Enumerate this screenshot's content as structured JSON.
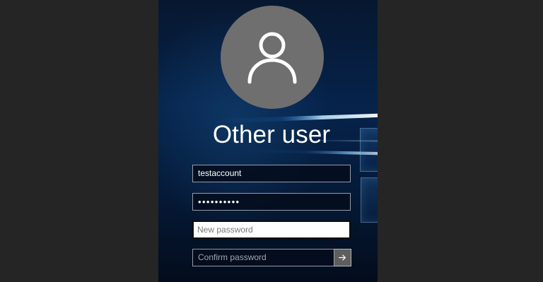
{
  "screen": {
    "background_color": "#252525",
    "panel_gradient_top": "#07172f",
    "panel_gradient_bottom": "#030c1c"
  },
  "user": {
    "avatar_icon": "user-icon",
    "title": "Other user"
  },
  "fields": {
    "username": {
      "value": "testaccount"
    },
    "password": {
      "value": "••••••••••"
    },
    "new_password": {
      "placeholder": "New password"
    },
    "confirm_password": {
      "placeholder": "Confirm password"
    }
  },
  "actions": {
    "submit_icon": "arrow-right-icon"
  }
}
